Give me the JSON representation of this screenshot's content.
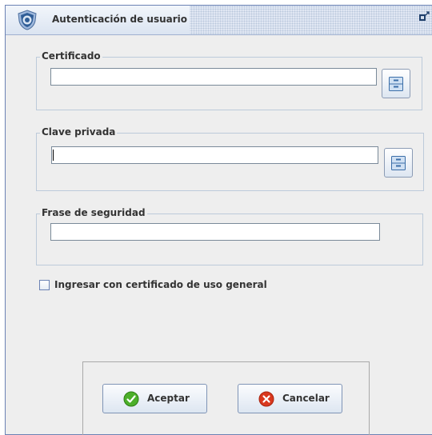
{
  "window": {
    "title": "Autenticación de usuario",
    "icons": {
      "app": "shield-icon",
      "restore": "restore-window-icon"
    }
  },
  "certificado": {
    "label": "Certificado",
    "value": "",
    "browse_icon": "file-cabinet-icon"
  },
  "clave_privada": {
    "label": "Clave privada",
    "value": "",
    "browse_icon": "file-cabinet-icon"
  },
  "frase_seguridad": {
    "label": "Frase de seguridad",
    "value": ""
  },
  "general_certificate": {
    "label": "Ingresar con certificado de uso general",
    "checked": false
  },
  "buttons": {
    "accept": {
      "label": "Aceptar",
      "icon": "check-circle-icon",
      "color": "#4caf2a"
    },
    "cancel": {
      "label": "Cancelar",
      "icon": "x-circle-icon",
      "color": "#d9381e"
    }
  },
  "colors": {
    "accent": "#6b82b4",
    "panel_background": "#eeeeee"
  }
}
